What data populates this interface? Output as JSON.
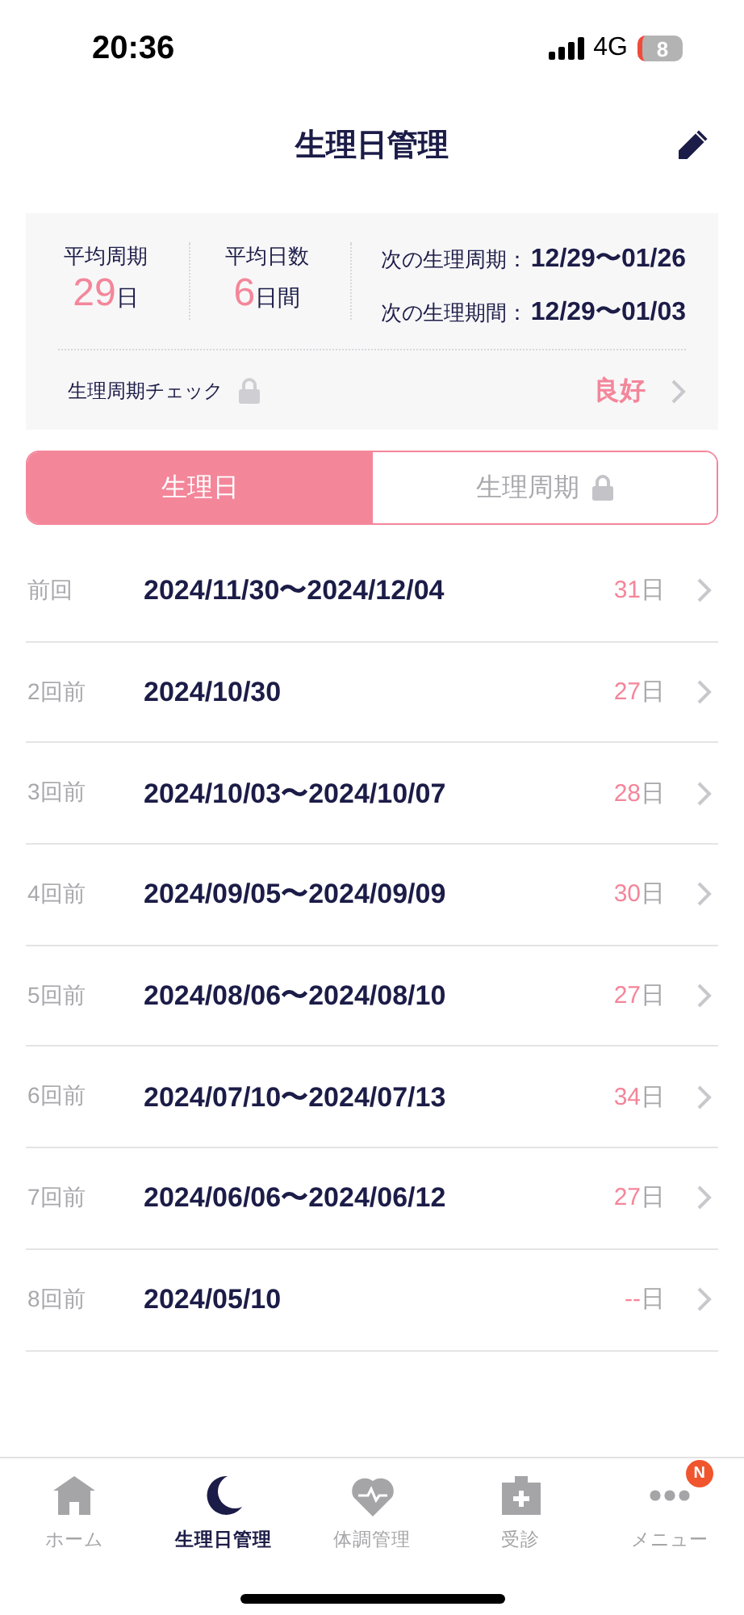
{
  "status_bar": {
    "time": "20:36",
    "network": "4G",
    "battery": "8"
  },
  "header": {
    "title": "生理日管理"
  },
  "summary": {
    "stats": [
      {
        "label": "平均周期",
        "value": "29",
        "unit": "日"
      },
      {
        "label": "平均日数",
        "value": "6",
        "unit": "日間"
      }
    ],
    "next": [
      {
        "label": "次の生理周期：",
        "value": "12/29〜01/26"
      },
      {
        "label": "次の生理期間：",
        "value": "12/29〜01/03"
      }
    ],
    "check": {
      "label": "生理周期チェック",
      "locked": true,
      "value": "良好"
    }
  },
  "tabs": [
    {
      "label": "生理日",
      "selected": true,
      "locked": false
    },
    {
      "label": "生理周期",
      "selected": false,
      "locked": true
    }
  ],
  "history": [
    {
      "label": "前回",
      "dates": "2024/11/30〜2024/12/04",
      "days": "31",
      "unit": "日"
    },
    {
      "label": "2回前",
      "dates": "2024/10/30",
      "days": "27",
      "unit": "日"
    },
    {
      "label": "3回前",
      "dates": "2024/10/03〜2024/10/07",
      "days": "28",
      "unit": "日"
    },
    {
      "label": "4回前",
      "dates": "2024/09/05〜2024/09/09",
      "days": "30",
      "unit": "日"
    },
    {
      "label": "5回前",
      "dates": "2024/08/06〜2024/08/10",
      "days": "27",
      "unit": "日"
    },
    {
      "label": "6回前",
      "dates": "2024/07/10〜2024/07/13",
      "days": "34",
      "unit": "日"
    },
    {
      "label": "7回前",
      "dates": "2024/06/06〜2024/06/12",
      "days": "27",
      "unit": "日"
    },
    {
      "label": "8回前",
      "dates": "2024/05/10",
      "days": "--",
      "unit": "日"
    }
  ],
  "nav": [
    {
      "kind": "home",
      "label": "ホーム",
      "selected": false
    },
    {
      "kind": "moon",
      "label": "生理日管理",
      "selected": true
    },
    {
      "kind": "health",
      "label": "体調管理",
      "selected": false
    },
    {
      "kind": "clinic",
      "label": "受診",
      "selected": false
    },
    {
      "kind": "menu",
      "label": "メニュー",
      "selected": false,
      "badge": "N"
    }
  ]
}
